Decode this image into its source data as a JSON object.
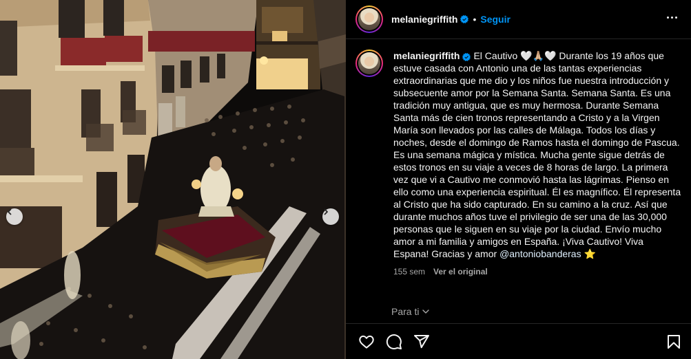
{
  "post": {
    "username": "melaniegriffith",
    "follow_label": "Seguir",
    "separator": "•",
    "caption": {
      "username": "melaniegriffith",
      "text_before_mention": "El Cautivo 🤍🙏🏼🤍 Durante los 19 años que estuve casada con Antonio una de las tantas experiencias extraordinarias que me dio y los niños fue nuestra introducción y subsecuente amor por la Semana Santa. Semana Santa. Es una tradición muy antigua, que es muy hermosa. Durante Semana Santa más de cien tronos representando a Cristo y a la Virgen María son llevados por las calles de Málaga. Todos los días y noches, desde el domingo de Ramos hasta el domingo de Pascua. Es una semana mágica y mística. Mucha gente sigue detrás de estos tronos en su viaje a veces de 8 horas de largo. La primera vez que vi a Cautivo me conmovió hasta las lágrimas. Pienso en ello como una experiencia espiritual. Él es magnífico. Él representa al Cristo que ha sido capturado. En su camino a la cruz. Así que durante muchos años tuve el privilegio de ser una de las 30,000 personas que le siguen en su viaje por la ciudad. Envío mucho amor a mi familia y amigos en España. ¡Viva Cautivo! Viva Espana! Gracias y amor ",
      "mention": "@antoniobanderas",
      "after_mention": " ⭐"
    },
    "time_ago": "155 sem",
    "see_original": "Ver el original",
    "for_you": "Para ti"
  },
  "icons": {
    "verified": "verified-badge-icon",
    "more": "more-options-icon",
    "like": "heart-icon",
    "comment": "comment-icon",
    "share": "share-icon",
    "save": "bookmark-icon",
    "prev": "chevron-left-icon",
    "next": "chevron-right-icon"
  },
  "colors": {
    "background": "#000000",
    "text": "#f5f5f5",
    "secondary": "#a8a8a8",
    "link": "#0095f6",
    "mention": "#e0f1ff",
    "divider": "#262626"
  }
}
